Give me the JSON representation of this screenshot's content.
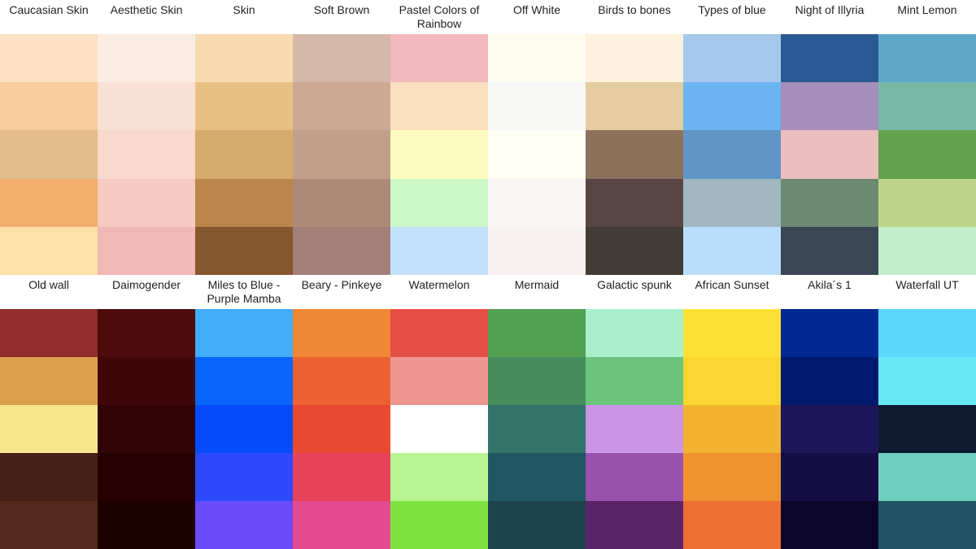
{
  "rows": [
    [
      {
        "title": "Caucasian Skin",
        "colors": [
          "#FBE0C3",
          "#F8CC9B",
          "#E3BD8C",
          "#F4AE6C",
          "#FDE1A6"
        ]
      },
      {
        "title": "Aesthetic Skin",
        "colors": [
          "#FBEDE2",
          "#FAE1D5",
          "#F8D9CB",
          "#F6CAC0",
          "#F1B8B6"
        ]
      },
      {
        "title": "Skin",
        "colors": [
          "#F8DBB1",
          "#E9C084",
          "#D7AB6C",
          "#BB864B",
          "#86562D"
        ]
      },
      {
        "title": "Soft Brown",
        "colors": [
          "#D4B9A8",
          "#CBA995",
          "#C29F8A",
          "#AD8A78",
          "#A47F77"
        ]
      },
      {
        "title": "Pastel Colors of Rainbow",
        "colors": [
          "#F3B8BE",
          "#F8DFBD",
          "#FEFBC0",
          "#CCF8C8",
          "#C4E1FB"
        ]
      },
      {
        "title": "Off White",
        "colors": [
          "#FFFDF0",
          "#F8F8F6",
          "#FFFEF5",
          "#FAF6F3",
          "#F7F1F1"
        ]
      },
      {
        "title": "Birds to bones",
        "colors": [
          "#FEF2DE",
          "#E5CCA0",
          "#8C725B",
          "#5A4545",
          "#423C36"
        ]
      },
      {
        "title": "Types of blue",
        "colors": [
          "#A6C8EC",
          "#6AB4F2",
          "#6195C5",
          "#A1B8C2",
          "#BADDFB"
        ]
      },
      {
        "title": "Night of Illyria",
        "colors": [
          "#2A5A93",
          "#A58EBA",
          "#EBBEBF",
          "#6C8972",
          "#3A4654"
        ]
      },
      {
        "title": "Mint Lemon",
        "colors": [
          "#5DA8C9",
          "#78B9A5",
          "#64A14C",
          "#BED48A",
          "#C2EDC8"
        ]
      }
    ],
    [
      {
        "title": "Old wall",
        "colors": [
          "#912D2D",
          "#DCA14B",
          "#F7E78C",
          "#452016",
          "#55291C"
        ]
      },
      {
        "title": "Daimogender",
        "colors": [
          "#4D0B0B",
          "#3F0708",
          "#320405",
          "#260102",
          "#1C0301"
        ]
      },
      {
        "title": "Miles to Blue - Purple Mamba",
        "colors": [
          "#42ADF9",
          "#0A66FB",
          "#064BFA",
          "#2C4AFB",
          "#6A4BFB"
        ]
      },
      {
        "title": "Beary - Pinkeye",
        "colors": [
          "#F08734",
          "#EC6132",
          "#E84931",
          "#E6435A",
          "#E64A8E"
        ]
      },
      {
        "title": "Watermelon",
        "colors": [
          "#E54E44",
          "#EF9591",
          "#FFFFFF",
          "#B8F592",
          "#7FE141"
        ]
      },
      {
        "title": "Mermaid",
        "colors": [
          "#52A051",
          "#478D5C",
          "#34736A",
          "#215762",
          "#1D444C"
        ]
      },
      {
        "title": "Galactic spunk",
        "colors": [
          "#A9EFCB",
          "#6CC47C",
          "#CA94E7",
          "#9952AD",
          "#5A2568"
        ]
      },
      {
        "title": "African Sunset",
        "colors": [
          "#FDE035",
          "#FBD633",
          "#F3B22F",
          "#F19230",
          "#EE6F32"
        ]
      },
      {
        "title": "Akila´s 1",
        "colors": [
          "#002892",
          "#001B6E",
          "#1C1559",
          "#140E44",
          "#0C062A"
        ]
      },
      {
        "title": "Waterfall UT",
        "colors": [
          "#5CD6FA",
          "#6AE7F5",
          "#0E1A2F",
          "#70CFBD",
          "#225465"
        ]
      }
    ]
  ]
}
